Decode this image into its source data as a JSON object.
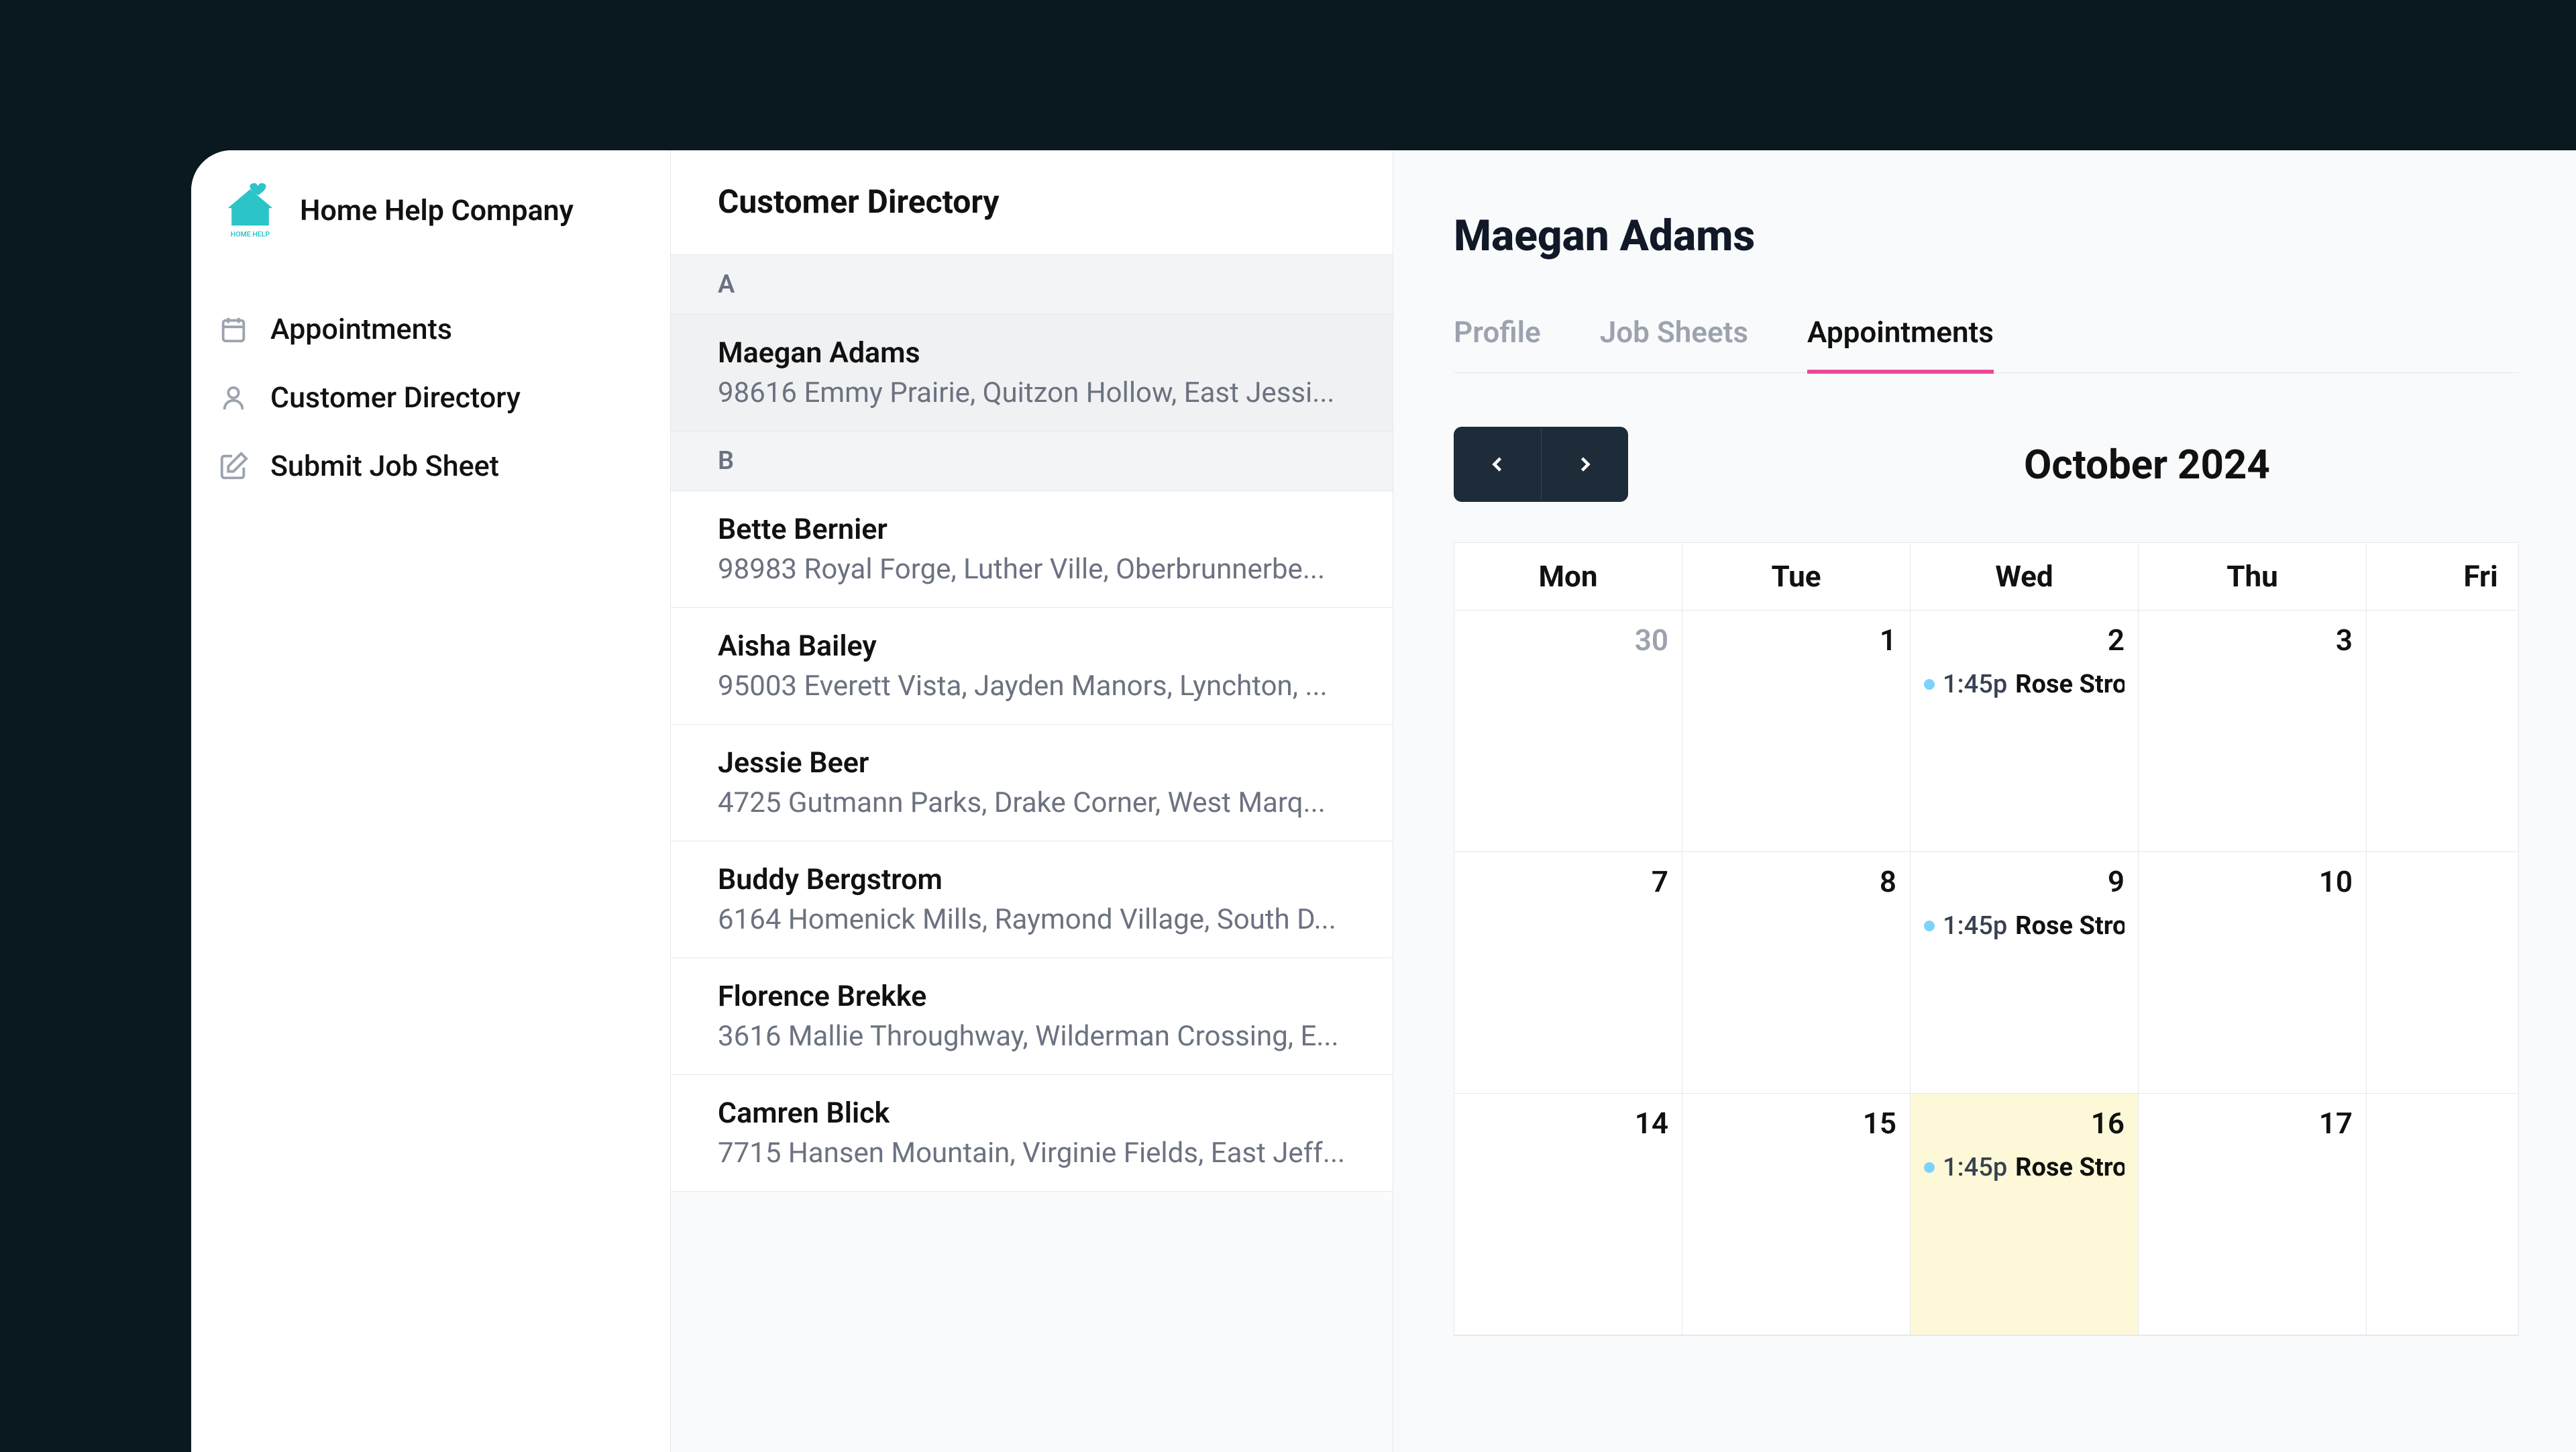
{
  "company_name": "Home Help Company",
  "nav": {
    "appointments": "Appointments",
    "directory": "Customer Directory",
    "submit": "Submit Job Sheet"
  },
  "directory": {
    "title": "Customer Directory",
    "groups": [
      {
        "letter": "A",
        "customers": [
          {
            "name": "Maegan Adams",
            "address": "98616 Emmy Prairie, Quitzon Hollow, East Jessi...",
            "selected": true
          }
        ]
      },
      {
        "letter": "B",
        "customers": [
          {
            "name": "Bette Bernier",
            "address": "98983 Royal Forge, Luther Ville, Oberbrunnerbe..."
          },
          {
            "name": "Aisha Bailey",
            "address": "95003 Everett Vista, Jayden Manors, Lynchton, ..."
          },
          {
            "name": "Jessie Beer",
            "address": "4725 Gutmann Parks, Drake Corner, West Marq..."
          },
          {
            "name": "Buddy Bergstrom",
            "address": "6164 Homenick Mills, Raymond Village, South D..."
          },
          {
            "name": "Florence Brekke",
            "address": "3616 Mallie Throughway, Wilderman Crossing, E..."
          },
          {
            "name": "Camren Blick",
            "address": "7715 Hansen Mountain, Virginie Fields, East Jeff..."
          }
        ]
      }
    ]
  },
  "detail": {
    "customer_name": "Maegan Adams",
    "tabs": {
      "profile": "Profile",
      "jobsheets": "Job Sheets",
      "appointments": "Appointments"
    },
    "calendar": {
      "month_label": "October 2024",
      "weekdays": [
        "Mon",
        "Tue",
        "Wed",
        "Thu",
        "Fri"
      ],
      "event_time": "1:45p",
      "event_title": "Rose Stro",
      "weeks": [
        [
          {
            "num": "30",
            "other": true
          },
          {
            "num": "1"
          },
          {
            "num": "2",
            "event": true
          },
          {
            "num": "3"
          },
          {
            "num": ""
          }
        ],
        [
          {
            "num": "7"
          },
          {
            "num": "8"
          },
          {
            "num": "9",
            "event": true
          },
          {
            "num": "10"
          },
          {
            "num": ""
          }
        ],
        [
          {
            "num": "14"
          },
          {
            "num": "15"
          },
          {
            "num": "16",
            "event": true,
            "today": true
          },
          {
            "num": "17"
          },
          {
            "num": ""
          }
        ]
      ]
    }
  }
}
